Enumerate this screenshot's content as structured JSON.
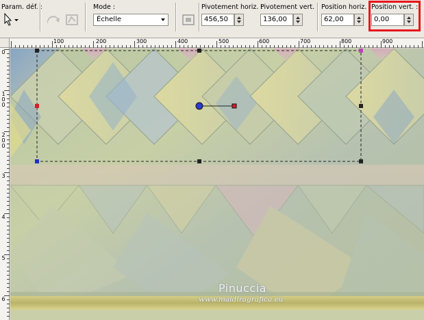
{
  "toolbar": {
    "presets_label": "Param. déf. :",
    "mode_label": "Mode :",
    "mode_value": "Échelle",
    "pivot_h_label": "Pivotement horiz. :",
    "pivot_h_value": "456,50",
    "pivot_v_label": "Pivotement vert. :",
    "pivot_v_value": "136,00",
    "pos_h_label": "Position horiz. :",
    "pos_h_value": "62,00",
    "pos_v_label": "Position vert. :",
    "pos_v_value": "0,00",
    "highlight_color": "#e8141c"
  },
  "ruler_top": [
    "100",
    "200",
    "300",
    "400",
    "500",
    "600",
    "700",
    "800",
    "900"
  ],
  "ruler_left": [
    "0",
    "1\n0\n0",
    "2\n0\n0",
    "3",
    "4",
    "5",
    "6"
  ],
  "watermark": {
    "title": "Pinuccia",
    "url": "www.maidiragrafica.eu"
  }
}
